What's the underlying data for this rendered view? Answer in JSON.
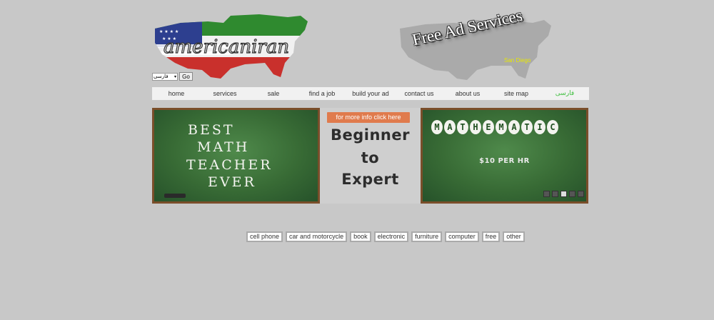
{
  "header": {
    "logo_text": "americaniran",
    "language_select_value": "فارسی",
    "go_label": "Go"
  },
  "ad": {
    "title": "Free Ad Services",
    "city": "San Diego"
  },
  "nav": {
    "items": [
      "home",
      "services",
      "sale",
      "find a job",
      "build your ad",
      "contact us",
      "about us",
      "site map",
      "فارسی"
    ]
  },
  "slider": {
    "left_board_lines": [
      "BEST",
      "MATH",
      "TEACHER",
      "EVER"
    ],
    "info_button": "for more info click here",
    "center_lines": [
      "Beginner",
      "to",
      "Expert"
    ],
    "right_board_title": "MATHEMATIC",
    "right_board_price": "$10 PER HR"
  },
  "categories": [
    "cell phone",
    "car and motorcycle",
    "book",
    "electronic",
    "furniture",
    "computer",
    "free",
    "other"
  ],
  "colors": {
    "background": "#c8c8c8",
    "nav_farsi": "#3fbf3f",
    "info_button": "#e07b4d",
    "ad_city": "#e8e800",
    "chalkboard": "#386b35"
  }
}
